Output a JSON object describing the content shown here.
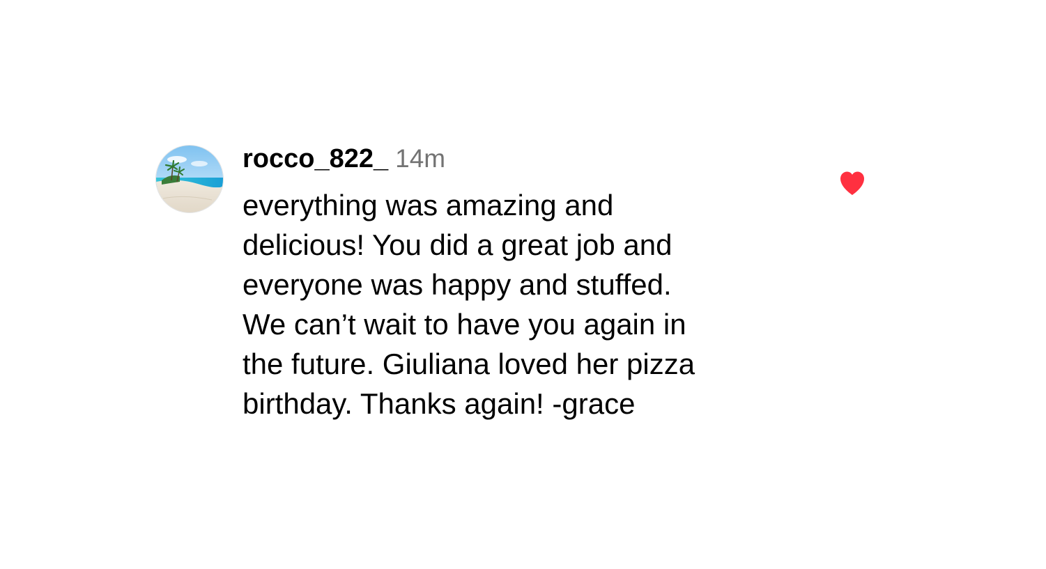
{
  "comment": {
    "username": "rocco_822_",
    "timestamp": "14m",
    "body_lines": [
      "everything was amazing and",
      "delicious! You did a great job and",
      "everyone was happy and stuffed.",
      "We can’t wait to have you again in",
      "the future. Giuliana loved her pizza",
      "birthday. Thanks again! -grace"
    ],
    "avatar_icon": "beach-avatar-icon",
    "like_icon": "heart-filled-icon",
    "liked": true
  },
  "colors": {
    "background": "#ffffff",
    "text": "#000000",
    "timestamp": "#737373",
    "like": "#ff3040"
  }
}
